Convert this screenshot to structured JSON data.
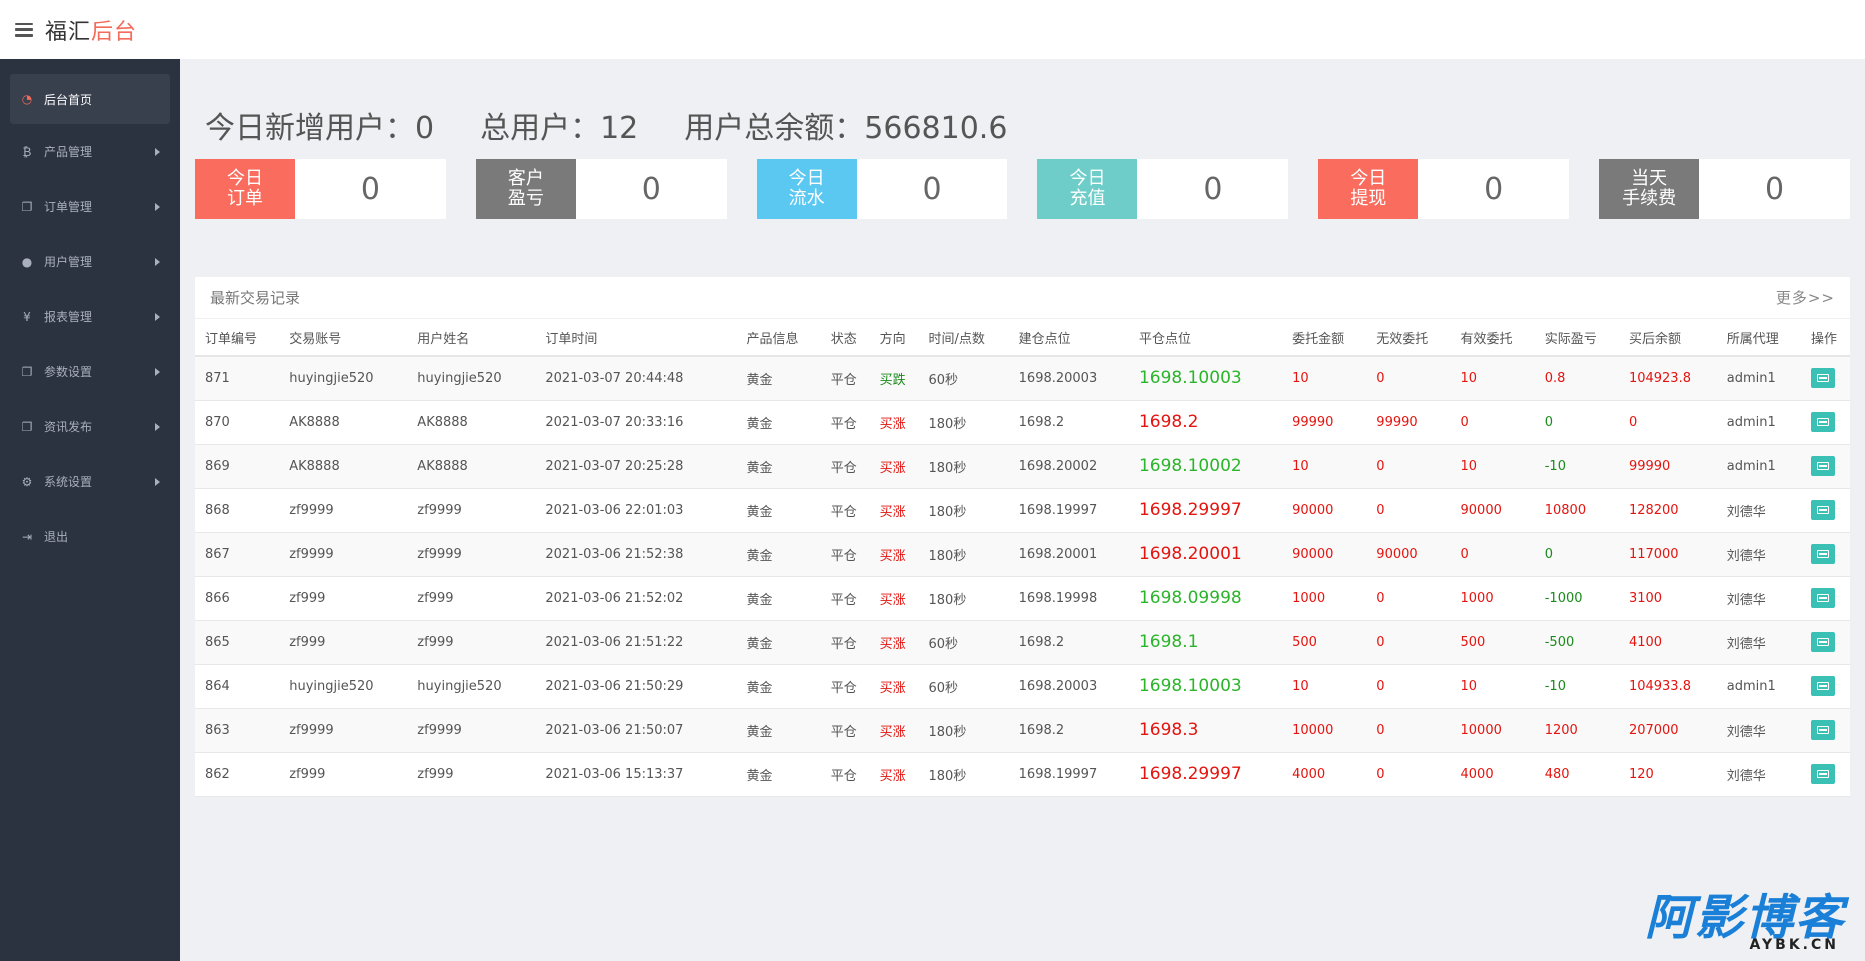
{
  "brand": {
    "prefix": "福汇",
    "accent": "后台"
  },
  "sidebar": {
    "items": [
      {
        "label": "后台首页",
        "icon": "dashboard-icon",
        "active": true,
        "caret": false
      },
      {
        "label": "产品管理",
        "icon": "bitcoin-icon",
        "active": false,
        "caret": true
      },
      {
        "label": "订单管理",
        "icon": "copy-icon",
        "active": false,
        "caret": true
      },
      {
        "label": "用户管理",
        "icon": "user-icon",
        "active": false,
        "caret": true
      },
      {
        "label": "报表管理",
        "icon": "yen-icon",
        "active": false,
        "caret": true
      },
      {
        "label": "参数设置",
        "icon": "copy-icon",
        "active": false,
        "caret": true
      },
      {
        "label": "资讯发布",
        "icon": "copy-icon",
        "active": false,
        "caret": true
      },
      {
        "label": "系统设置",
        "icon": "gears-icon",
        "active": false,
        "caret": true
      },
      {
        "label": "退出",
        "icon": "sign-out-icon",
        "active": false,
        "caret": false
      }
    ]
  },
  "summary": {
    "new_users": "今日新增用户：0",
    "total_users": "总用户：12",
    "total_balance": "用户总余额：566810.6"
  },
  "stats": [
    {
      "label": "今日\n订单",
      "value": "0",
      "color": "#f96c5e"
    },
    {
      "label": "客户\n盈亏",
      "value": "0",
      "color": "#7a7a7a"
    },
    {
      "label": "今日\n流水",
      "value": "0",
      "color": "#5bc8f2"
    },
    {
      "label": "今日\n充值",
      "value": "0",
      "color": "#6ecdc9"
    },
    {
      "label": "今日\n提现",
      "value": "0",
      "color": "#f96c5e"
    },
    {
      "label": "当天\n手续费",
      "value": "0",
      "color": "#7a7a7a"
    }
  ],
  "panel": {
    "title": "最新交易记录",
    "more": "更多>>"
  },
  "table": {
    "headers": [
      "订单编号",
      "交易账号",
      "用户姓名",
      "订单时间",
      "产品信息",
      "状态",
      "方向",
      "时间/点数",
      "建仓点位",
      "平仓点位",
      "委托金额",
      "无效委托",
      "有效委托",
      "实际盈亏",
      "买后余额",
      "所属代理",
      "操作"
    ],
    "rows": [
      [
        "871",
        "huyingjie520",
        "huyingjie520",
        "2021-03-07 20:44:48",
        "黄金",
        "平仓",
        "买跌",
        "60秒",
        "1698.20003",
        "1698.10003",
        "10",
        "0",
        "10",
        "0.8",
        "104923.8",
        "admin1"
      ],
      [
        "870",
        "AK8888",
        "AK8888",
        "2021-03-07 20:33:16",
        "黄金",
        "平仓",
        "买涨",
        "180秒",
        "1698.2",
        "1698.2",
        "99990",
        "99990",
        "0",
        "0",
        "0",
        "admin1"
      ],
      [
        "869",
        "AK8888",
        "AK8888",
        "2021-03-07 20:25:28",
        "黄金",
        "平仓",
        "买涨",
        "180秒",
        "1698.20002",
        "1698.10002",
        "10",
        "0",
        "10",
        "-10",
        "99990",
        "admin1"
      ],
      [
        "868",
        "zf9999",
        "zf9999",
        "2021-03-06 22:01:03",
        "黄金",
        "平仓",
        "买涨",
        "180秒",
        "1698.19997",
        "1698.29997",
        "90000",
        "0",
        "90000",
        "10800",
        "128200",
        "刘德华"
      ],
      [
        "867",
        "zf9999",
        "zf9999",
        "2021-03-06 21:52:38",
        "黄金",
        "平仓",
        "买涨",
        "180秒",
        "1698.20001",
        "1698.20001",
        "90000",
        "90000",
        "0",
        "0",
        "117000",
        "刘德华"
      ],
      [
        "866",
        "zf999",
        "zf999",
        "2021-03-06 21:52:02",
        "黄金",
        "平仓",
        "买涨",
        "180秒",
        "1698.19998",
        "1698.09998",
        "1000",
        "0",
        "1000",
        "-1000",
        "3100",
        "刘德华"
      ],
      [
        "865",
        "zf999",
        "zf999",
        "2021-03-06 21:51:22",
        "黄金",
        "平仓",
        "买涨",
        "60秒",
        "1698.2",
        "1698.1",
        "500",
        "0",
        "500",
        "-500",
        "4100",
        "刘德华"
      ],
      [
        "864",
        "huyingjie520",
        "huyingjie520",
        "2021-03-06 21:50:29",
        "黄金",
        "平仓",
        "买涨",
        "60秒",
        "1698.20003",
        "1698.10003",
        "10",
        "0",
        "10",
        "-10",
        "104933.8",
        "admin1"
      ],
      [
        "863",
        "zf9999",
        "zf9999",
        "2021-03-06 21:50:07",
        "黄金",
        "平仓",
        "买涨",
        "180秒",
        "1698.2",
        "1698.3",
        "10000",
        "0",
        "10000",
        "1200",
        "207000",
        "刘德华"
      ],
      [
        "862",
        "zf999",
        "zf999",
        "2021-03-06 15:13:37",
        "黄金",
        "平仓",
        "买涨",
        "180秒",
        "1698.19997",
        "1698.29997",
        "4000",
        "0",
        "4000",
        "480",
        "120",
        "刘德华"
      ]
    ],
    "close_colors": [
      "green",
      "red",
      "green",
      "red",
      "red",
      "green",
      "green",
      "green",
      "red",
      "red"
    ],
    "pnl_colors": [
      "red",
      "green",
      "green",
      "red",
      "green",
      "green",
      "green",
      "green",
      "red",
      "red"
    ],
    "direction_colors": [
      "green",
      "red",
      "red",
      "red",
      "red",
      "red",
      "red",
      "red",
      "red",
      "red"
    ]
  },
  "watermark": {
    "big": "阿影博客",
    "small": "AYBK.CN"
  }
}
